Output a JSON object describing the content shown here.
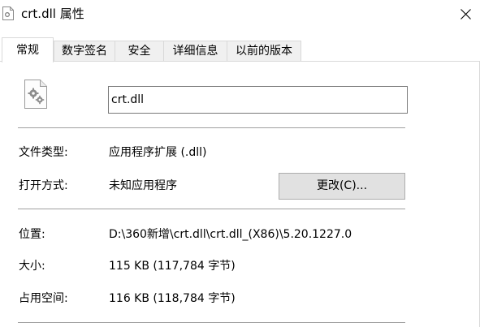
{
  "window": {
    "title": "crt.dll 属性",
    "title_icon": "document-icon",
    "close_icon": "close-icon"
  },
  "tabs": [
    {
      "label": "常规",
      "active": true
    },
    {
      "label": "数字签名",
      "active": false
    },
    {
      "label": "安全",
      "active": false
    },
    {
      "label": "详细信息",
      "active": false
    },
    {
      "label": "以前的版本",
      "active": false
    }
  ],
  "general": {
    "file_icon": "gear-file-icon",
    "file_name": "crt.dll",
    "file_type_label": "文件类型:",
    "file_type_value": "应用程序扩展 (.dll)",
    "open_with_label": "打开方式:",
    "open_with_value": "未知应用程序",
    "change_button": "更改(C)...",
    "location_label": "位置:",
    "location_value": "D:\\360新增\\crt.dll\\crt.dll_(X86)\\5.20.1227.0",
    "size_label": "大小:",
    "size_value": "115 KB (117,784 字节)",
    "size_on_disk_label": "占用空间:",
    "size_on_disk_value": "116 KB (118,784 字节)"
  }
}
